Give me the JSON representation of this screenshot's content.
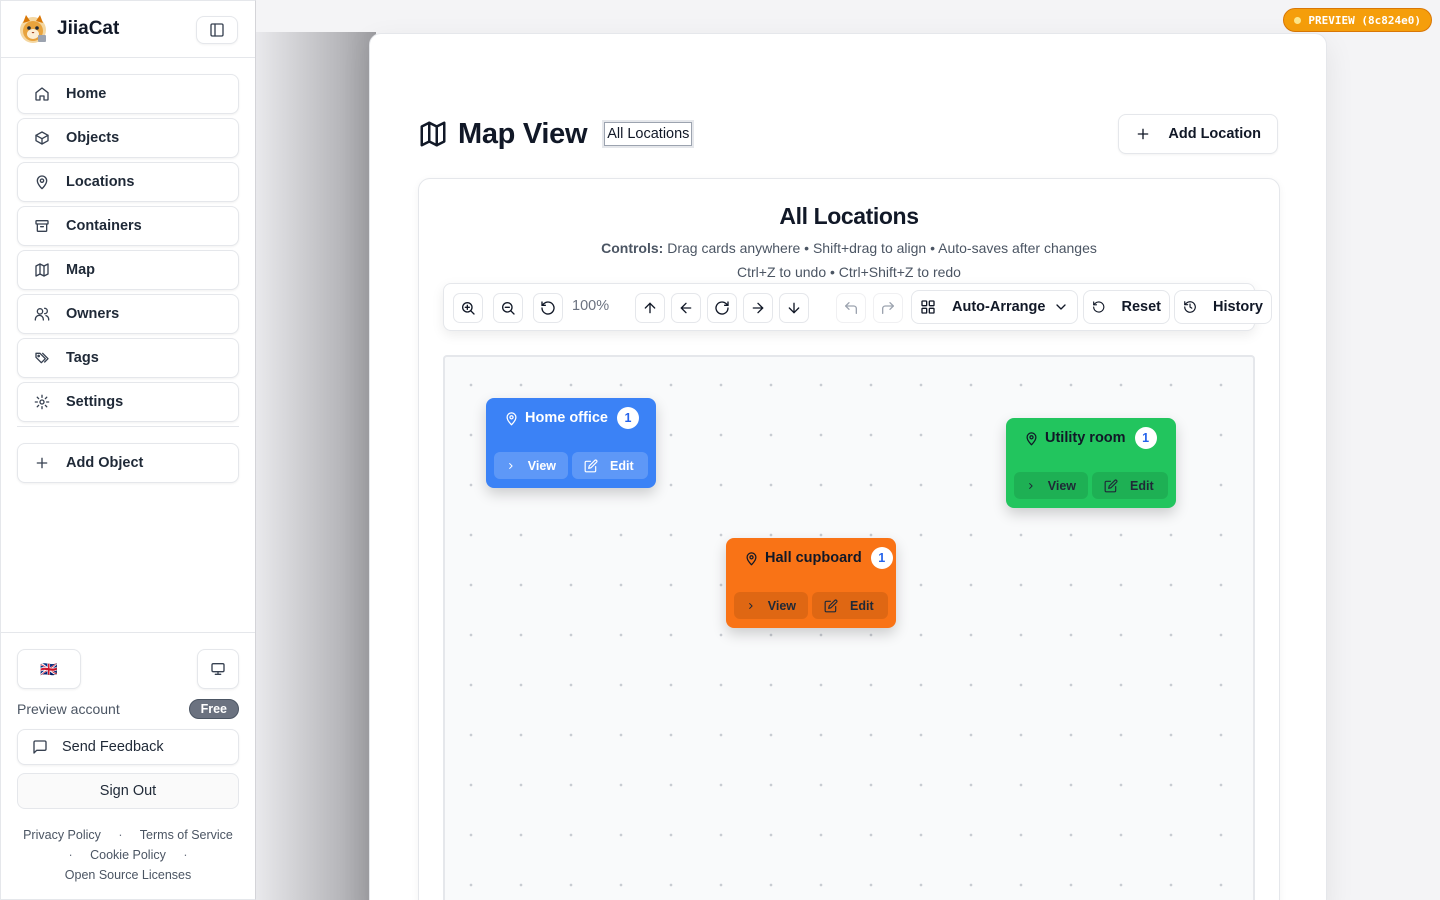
{
  "app": {
    "name": "JiiaCat"
  },
  "preview_badge": {
    "label": "PREVIEW (8c824e0)",
    "color": "#f59e0b"
  },
  "sidebar": {
    "items": [
      {
        "label": "Home",
        "icon": "home-icon"
      },
      {
        "label": "Objects",
        "icon": "box-icon"
      },
      {
        "label": "Locations",
        "icon": "map-pin-icon"
      },
      {
        "label": "Containers",
        "icon": "archive-icon"
      },
      {
        "label": "Map",
        "icon": "map-icon"
      },
      {
        "label": "Owners",
        "icon": "users-icon"
      },
      {
        "label": "Tags",
        "icon": "tags-icon"
      },
      {
        "label": "Settings",
        "icon": "gear-icon"
      }
    ],
    "add_object_label": "Add Object",
    "language_flag": "🇬🇧",
    "account_label": "Preview account",
    "plan_badge": "Free",
    "feedback_label": "Send Feedback",
    "signout_label": "Sign Out",
    "legal": {
      "privacy": "Privacy Policy",
      "terms": "Terms of Service",
      "cookie": "Cookie Policy",
      "licenses": "Open Source Licenses",
      "separator": "·"
    }
  },
  "page": {
    "title": "Map View",
    "scope_select": "All Locations",
    "add_location_label": "Add Location"
  },
  "map": {
    "title": "All Locations",
    "controls_label": "Controls:",
    "controls_text": "Drag cards anywhere • Shift+drag to align • Auto-saves after changes",
    "shortcuts_text": "Ctrl+Z to undo • Ctrl+Shift+Z to redo",
    "zoom_level": "100%",
    "auto_arrange_label": "Auto-Arrange",
    "reset_label": "Reset",
    "history_label": "History",
    "cards": [
      {
        "name": "Home office",
        "count": "1",
        "color": "#3b82f6",
        "view_label": "View",
        "edit_label": "Edit"
      },
      {
        "name": "Utility room",
        "count": "1",
        "color": "#22c55e",
        "view_label": "View",
        "edit_label": "Edit"
      },
      {
        "name": "Hall cupboard",
        "count": "1",
        "color": "#f97316",
        "view_label": "View",
        "edit_label": "Edit"
      }
    ]
  }
}
